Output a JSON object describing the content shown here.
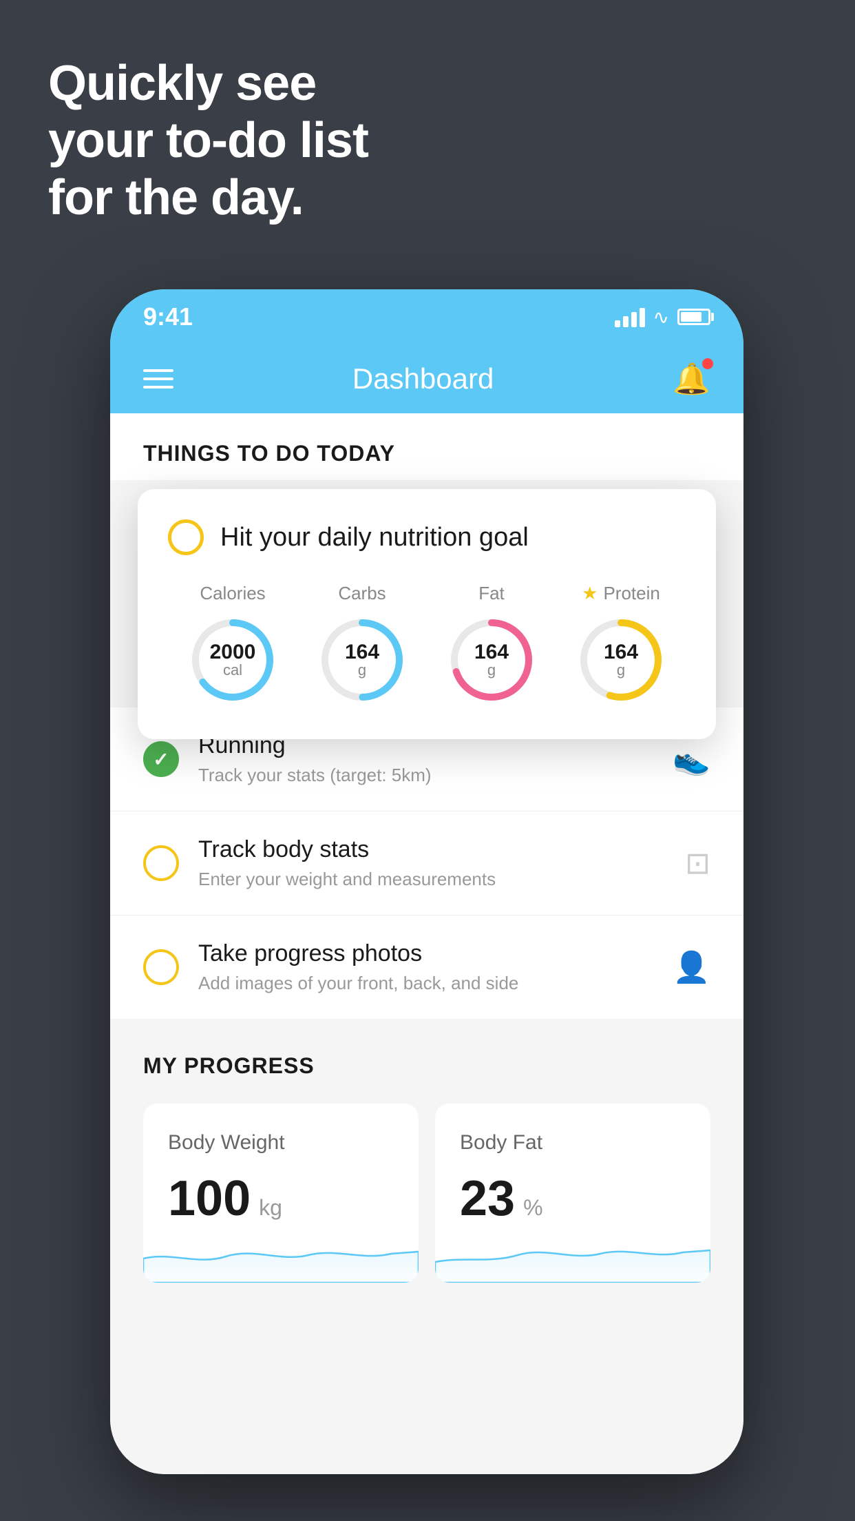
{
  "hero": {
    "line1": "Quickly see",
    "line2": "your to-do list",
    "line3": "for the day."
  },
  "phone": {
    "status": {
      "time": "9:41"
    },
    "nav": {
      "title": "Dashboard"
    },
    "things_section": {
      "title": "THINGS TO DO TODAY"
    },
    "nutrition_card": {
      "title": "Hit your daily nutrition goal",
      "stats": [
        {
          "label": "Calories",
          "value": "2000",
          "unit": "cal",
          "color": "#5bc8f5",
          "progress": 65
        },
        {
          "label": "Carbs",
          "value": "164",
          "unit": "g",
          "color": "#5bc8f5",
          "progress": 50
        },
        {
          "label": "Fat",
          "value": "164",
          "unit": "g",
          "color": "#f06292",
          "progress": 70
        },
        {
          "label": "Protein",
          "value": "164",
          "unit": "g",
          "color": "#f5c518",
          "progress": 55,
          "star": true
        }
      ]
    },
    "todos": [
      {
        "name": "Running",
        "desc": "Track your stats (target: 5km)",
        "completed": true,
        "icon": "👟"
      },
      {
        "name": "Track body stats",
        "desc": "Enter your weight and measurements",
        "completed": false,
        "icon": "⚖️"
      },
      {
        "name": "Take progress photos",
        "desc": "Add images of your front, back, and side",
        "completed": false,
        "icon": "👤"
      }
    ],
    "progress_section": {
      "title": "MY PROGRESS",
      "cards": [
        {
          "label": "Body Weight",
          "value": "100",
          "unit": "kg"
        },
        {
          "label": "Body Fat",
          "value": "23",
          "unit": "%"
        }
      ]
    }
  }
}
